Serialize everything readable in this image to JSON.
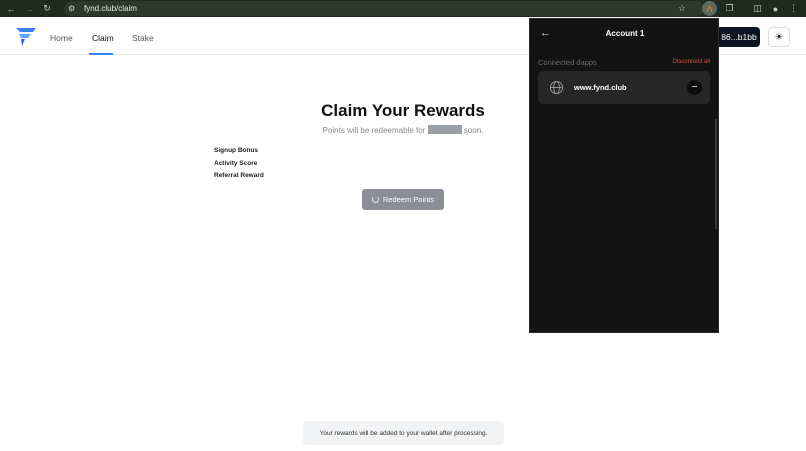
{
  "browser": {
    "url": "fynd.club/claim",
    "back_icon": "back-arrow-icon",
    "forward_icon": "forward-arrow-icon",
    "reload_icon": "reload-icon"
  },
  "header": {
    "nav": [
      {
        "label": "Home"
      },
      {
        "label": "Claim"
      },
      {
        "label": "Stake"
      }
    ],
    "wallet_address": "86...b1bb",
    "accent": "#3b82f6"
  },
  "main": {
    "title": "Claim Your Rewards",
    "subtitle_before": "Points will be redeemable for",
    "subtitle_after": "soon.",
    "rewards": [
      {
        "label": "Signup Bonus"
      },
      {
        "label": "Activity Score"
      },
      {
        "label": "Referral Reward"
      }
    ],
    "redeem_label": "Redeem Points",
    "toast": "Your rewards will be added to your wallet after processing."
  },
  "wallet_popup": {
    "title": "Account 1",
    "section_label": "Connected dapps",
    "disconnect_all": "Disconnect all",
    "dapps": [
      {
        "name": "www.fynd.club"
      }
    ],
    "danger_color": "#e0533a"
  }
}
